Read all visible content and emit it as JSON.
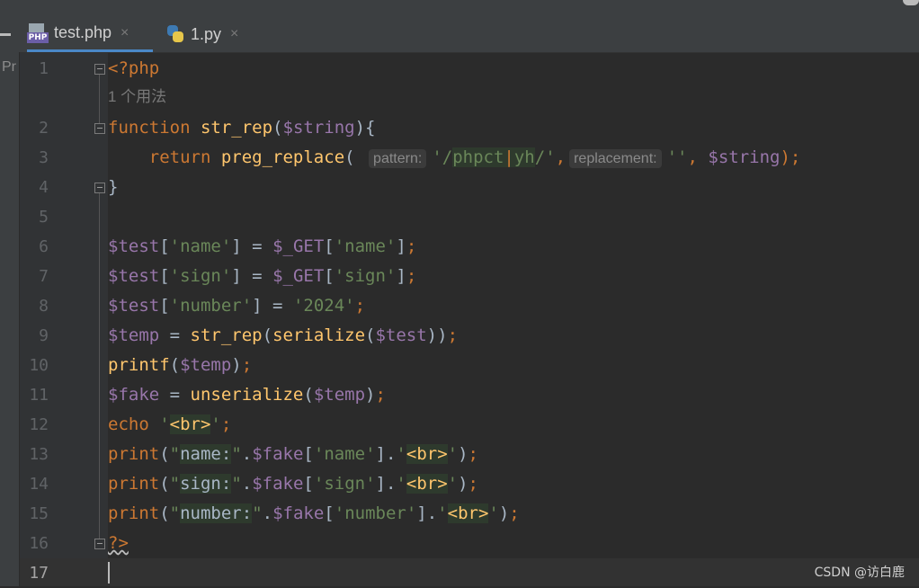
{
  "tabs": [
    {
      "label": "test.php",
      "close": "×",
      "active": true,
      "icon": "php-file-icon"
    },
    {
      "label": "1.py",
      "close": "×",
      "active": false,
      "icon": "python-file-icon"
    }
  ],
  "sidebar": {
    "project_label": "Pr"
  },
  "line_numbers": [
    "1",
    "2",
    "3",
    "4",
    "5",
    "6",
    "7",
    "8",
    "9",
    "10",
    "11",
    "12",
    "13",
    "14",
    "15",
    "16",
    "17"
  ],
  "usage_hint": "1 个用法",
  "code": {
    "l1": "<?php",
    "l2_kw": "function",
    "l2_fn": "str_rep",
    "l2_p1": "(",
    "l2_var": "$string",
    "l2_p2": "){",
    "l3_kw": "return",
    "l3_fn": "preg_replace",
    "l3_p": "(",
    "l3_hint1": "pattern:",
    "l3_str1": "'/",
    "l3_re1": "phpct",
    "l3_bar": "|",
    "l3_re2": "yh",
    "l3_str2": "/'",
    "l3_comma1": ",",
    "l3_hint2": "replacement:",
    "l3_str3": "''",
    "l3_comma2": ", ",
    "l3_var": "$string",
    "l3_end": ");",
    "l4": "}",
    "l6_var": "$test",
    "l6_b1": "[",
    "l6_s1": "'name'",
    "l6_b2": "] = ",
    "l6_get": "$_GET",
    "l6_b3": "[",
    "l6_s2": "'name'",
    "l6_b4": "]",
    "l6_end": ";",
    "l7_var": "$test",
    "l7_b1": "[",
    "l7_s1": "'sign'",
    "l7_b2": "] = ",
    "l7_get": "$_GET",
    "l7_b3": "[",
    "l7_s2": "'sign'",
    "l7_b4": "]",
    "l7_end": ";",
    "l8_var": "$test",
    "l8_b1": "[",
    "l8_s1": "'number'",
    "l8_b2": "] = ",
    "l8_s2": "'2024'",
    "l8_end": ";",
    "l9_var": "$temp",
    "l9_eq": " = ",
    "l9_fn1": "str_rep",
    "l9_p1": "(",
    "l9_fn2": "serialize",
    "l9_p2": "(",
    "l9_var2": "$test",
    "l9_p3": "))",
    "l9_end": ";",
    "l10_fn": "printf",
    "l10_p1": "(",
    "l10_var": "$temp",
    "l10_p2": ")",
    "l10_end": ";",
    "l11_var": "$fake",
    "l11_eq": " = ",
    "l11_fn": "unserialize",
    "l11_p1": "(",
    "l11_var2": "$temp",
    "l11_p2": ")",
    "l11_end": ";",
    "l12_kw": "echo",
    "l12_q1": " '",
    "l12_tag": "<br>",
    "l12_q2": "'",
    "l12_end": ";",
    "l13_fn": "print",
    "l13_p": "(",
    "l13_q1": "\"",
    "l13_txt": "name:",
    "l13_q2": "\"",
    "l13_dot1": ".",
    "l13_var": "$fake",
    "l13_b1": "[",
    "l13_key": "'name'",
    "l13_b2": "]",
    "l13_dot2": ".",
    "l13_q3": "'",
    "l13_tag": "<br>",
    "l13_q4": "'",
    "l13_end1": ")",
    "l13_end2": ";",
    "l14_fn": "print",
    "l14_p": "(",
    "l14_q1": "\"",
    "l14_txt": "sign:",
    "l14_q2": "\"",
    "l14_dot1": ".",
    "l14_var": "$fake",
    "l14_b1": "[",
    "l14_key": "'sign'",
    "l14_b2": "]",
    "l14_dot2": ".",
    "l14_q3": "'",
    "l14_tag": "<br>",
    "l14_q4": "'",
    "l14_end1": ")",
    "l14_end2": ";",
    "l15_fn": "print",
    "l15_p": "(",
    "l15_q1": "\"",
    "l15_txt": "number:",
    "l15_q2": "\"",
    "l15_dot1": ".",
    "l15_var": "$fake",
    "l15_b1": "[",
    "l15_key": "'number'",
    "l15_b2": "]",
    "l15_dot2": ".",
    "l15_q3": "'",
    "l15_tag": "<br>",
    "l15_q4": "'",
    "l15_end1": ")",
    "l15_end2": ";",
    "l16": "?>"
  },
  "watermark": "CSDN @访白鹿",
  "colors": {
    "keyword": "#cc7832",
    "function": "#ffc66d",
    "variable": "#9876aa",
    "string": "#6a8759",
    "text": "#a9b7c6",
    "background": "#2b2b2b"
  }
}
